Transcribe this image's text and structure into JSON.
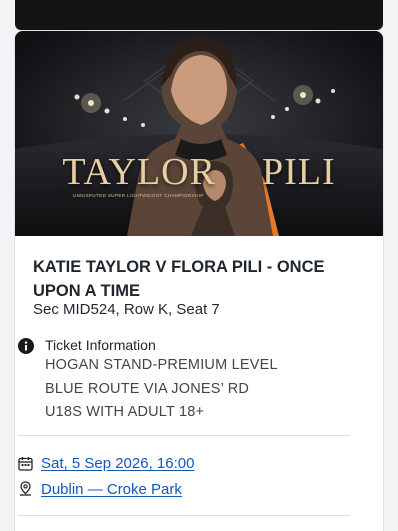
{
  "hero": {
    "title_left": "TAYLOR",
    "title_right": "PILI",
    "subtitle": "UNDISPUTED SUPER LIGHTWEIGHT CHAMPIONSHIP"
  },
  "event": {
    "title": "KATIE TAYLOR V FLORA PILI - ONCE UPON A TIME",
    "seat": "Sec MID524, Row K, Seat 7"
  },
  "ticket_info": {
    "label": "Ticket Information",
    "lines": [
      "HOGAN STAND-PREMIUM LEVEL",
      "BLUE ROUTE VIA JONES’ RD",
      "U18S WITH ADULT 18+"
    ]
  },
  "details": {
    "date": "Sat, 5 Sep 2026, 16:00",
    "venue": "Dublin — Croke Park"
  },
  "colors": {
    "link": "#1458b8",
    "text": "#1f262d",
    "gold": "#e6cfa0"
  },
  "icons": {
    "info": "info-icon",
    "calendar": "calendar-icon",
    "location": "location-pin-icon"
  }
}
